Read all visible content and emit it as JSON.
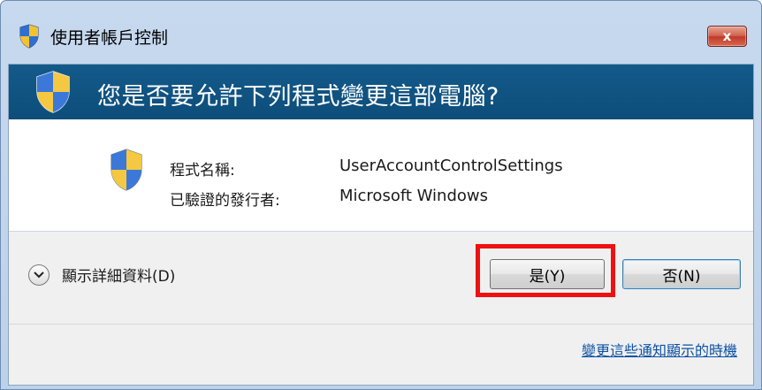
{
  "window": {
    "title": "使用者帳戶控制",
    "close_label": "x"
  },
  "banner": {
    "question": "您是否要允許下列程式變更這部電腦?"
  },
  "program": {
    "name_label": "程式名稱:",
    "name_value": "UserAccountControlSettings",
    "publisher_label": "已驗證的發行者:",
    "publisher_value": "Microsoft Windows"
  },
  "actions": {
    "details_label": "顯示詳細資料(D)",
    "yes_label": "是(Y)",
    "no_label": "否(N)",
    "settings_link": "變更這些通知顯示的時機"
  },
  "icons": {
    "title": "shield-icon",
    "banner": "shield-icon",
    "program": "shield-icon",
    "details": "chevron-down-icon"
  },
  "colors": {
    "banner": "#0d4d7a",
    "highlight": "#ee1111",
    "link": "#0b51a5",
    "close": "#c0392b"
  }
}
